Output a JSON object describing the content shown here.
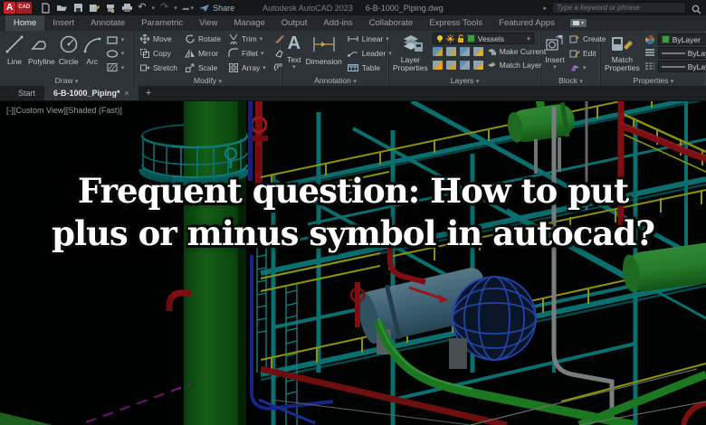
{
  "titlebar": {
    "logo_a": "A",
    "logo_cad": "CAD",
    "share": "Share",
    "app_title": "Autodesk AutoCAD 2023",
    "doc_title": "6-B-1000_Piping.dwg",
    "search_placeholder": "Type a keyword or phrase"
  },
  "tabs": [
    "Home",
    "Insert",
    "Annotate",
    "Parametric",
    "View",
    "Manage",
    "Output",
    "Add-ins",
    "Collaborate",
    "Express Tools",
    "Featured Apps"
  ],
  "ribbon": {
    "draw": {
      "label": "Draw",
      "line": "Line",
      "polyline": "Polyline",
      "circle": "Circle",
      "arc": "Arc"
    },
    "modify": {
      "label": "Modify",
      "move": "Move",
      "copy": "Copy",
      "stretch": "Stretch",
      "rotate": "Rotate",
      "mirror": "Mirror",
      "scale": "Scale",
      "trim": "Trim",
      "fillet": "Fillet",
      "array": "Array"
    },
    "annotation": {
      "label": "Annotation",
      "text": "Text",
      "dimension": "Dimension",
      "linear": "Linear",
      "leader": "Leader",
      "table": "Table"
    },
    "layers": {
      "label": "Layers",
      "layer_properties": "Layer Properties",
      "current_layer": "Vessels",
      "make_current": "Make Current",
      "match_layer": "Match Layer"
    },
    "block": {
      "label": "Block",
      "insert": "Insert",
      "create": "Create",
      "edit": "Edit"
    },
    "properties": {
      "label": "Properties",
      "match_properties": "Match Properties",
      "color_value": "ByLayer",
      "lineweight_value": "ByLayer",
      "linetype_value": "ByLayer"
    }
  },
  "filetabs": {
    "start": "Start",
    "doc": "6-B-1000_Piping*",
    "close": "×",
    "new_tab": "+"
  },
  "viewport": {
    "controls": "[-][Custom View][Shaded (Fast)]",
    "headline_line1": "Frequent question: How to put",
    "headline_line2": "plus or minus symbol in autocad?"
  },
  "icons": {
    "chevron_down": "▾",
    "chevron_right": "▸",
    "undo": "↶",
    "redo": "↷"
  },
  "colors": {
    "column_green": "#15701a",
    "vessel_green": "#2f9e2f",
    "structure_teal": "#0d8f8f",
    "railing_yellow": "#b7bd12",
    "pipe_red": "#a31418",
    "pipe_blue": "#1d2fae",
    "exchanger_wire_blue": "#2d55d4",
    "magenta_line": "#a020a0",
    "layer_swatch_green": "#3f9b3f",
    "logo_red": "#c2252b"
  }
}
